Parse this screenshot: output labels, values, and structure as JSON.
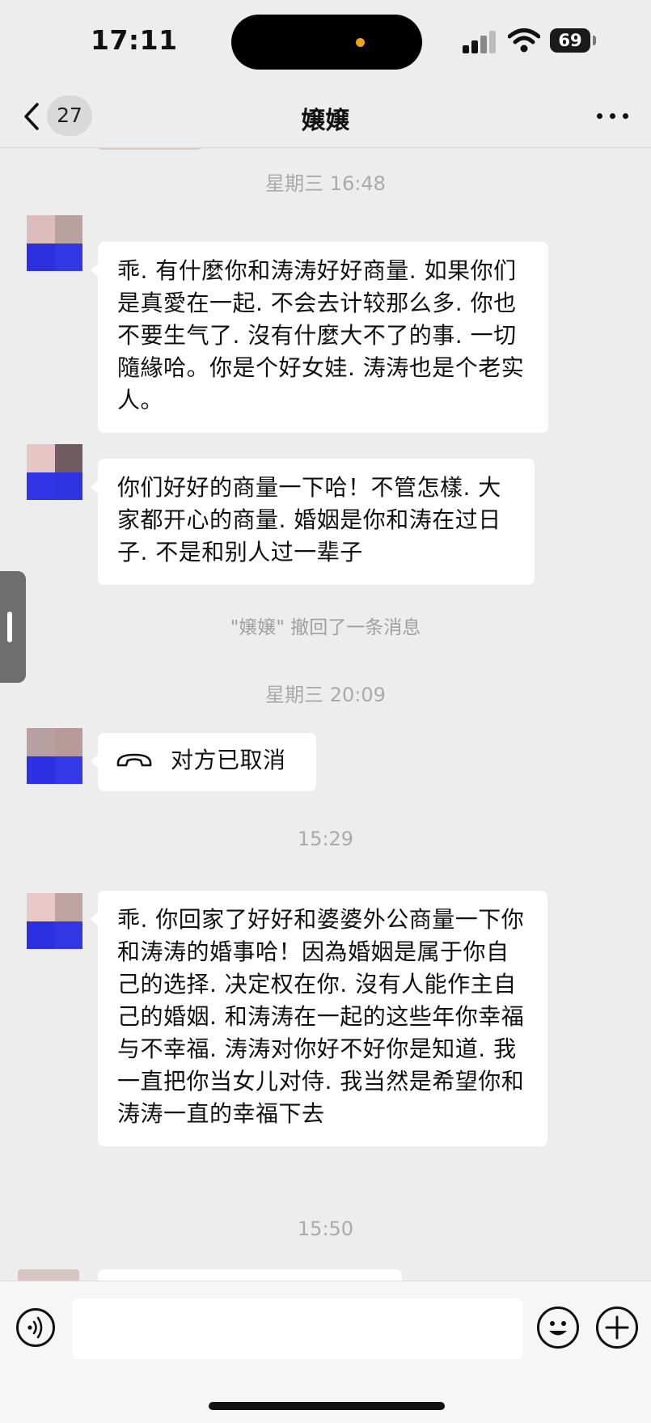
{
  "status_bar": {
    "time": "17:11",
    "battery": "69",
    "icons": [
      "signal-icon",
      "wifi-icon",
      "battery-icon"
    ]
  },
  "header": {
    "unread_count": "27",
    "title": "嬢嬢",
    "icons": [
      "chevron-left-icon",
      "more-icon"
    ]
  },
  "messages": [
    {
      "type": "timestamp",
      "text": "星期三 16:48"
    },
    {
      "type": "text",
      "text": "乖. 有什麼你和涛涛好好商量. 如果你们是真愛在一起. 不会去计较那么多. 你也不要生气了. 沒有什麼大不了的事. 一切隨緣哈。你是个好女娃. 涛涛也是个老实人。"
    },
    {
      "type": "text",
      "text": "你们好好的商量一下哈！不管怎樣. 大家都开心的商量. 婚姻是你和涛在过日子. 不是和别人过一辈子"
    },
    {
      "type": "system",
      "text": "\"嬢嬢\" 撤回了一条消息"
    },
    {
      "type": "timestamp",
      "text": "星期三 20:09"
    },
    {
      "type": "call",
      "text": "对方已取消",
      "icon": "phone-hangup-icon"
    },
    {
      "type": "timestamp",
      "text": "15:29"
    },
    {
      "type": "text",
      "text": "乖. 你回家了好好和婆婆外公商量一下你和涛涛的婚事哈！因為婚姻是属于你自己的选择. 决定权在你. 沒有人能作主自己的婚姻. 和涛涛在一起的这些年你幸福与不幸福. 涛涛对你好不好你是知道. 我一直把你当女儿对侍. 我当然是希望你和涛涛一直的幸福下去"
    },
    {
      "type": "timestamp",
      "text": "15:50"
    }
  ],
  "input_bar": {
    "icons": [
      "voice-icon",
      "emoji-icon",
      "plus-icon"
    ]
  },
  "colors": {
    "background": "#ededed",
    "bubble": "#ffffff",
    "timestamp_text": "#aaaaaa",
    "avatar_mosaic_blue": "#2f35e8"
  }
}
